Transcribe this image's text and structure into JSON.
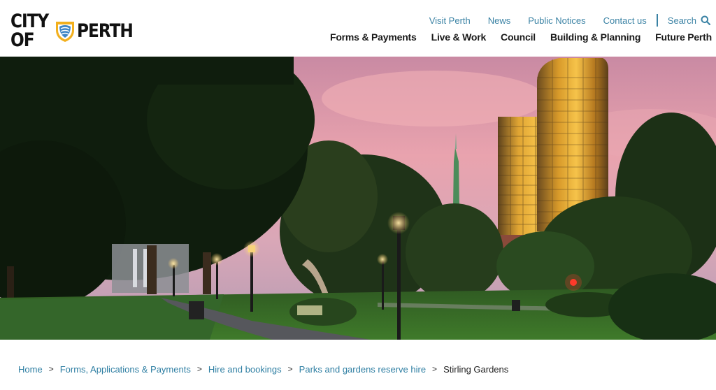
{
  "logo": {
    "left_text": "CITY OF",
    "right_text": "PERTH"
  },
  "utility_nav": {
    "links": [
      "Visit Perth",
      "News",
      "Public Notices",
      "Contact us"
    ],
    "search_label": "Search"
  },
  "main_nav": {
    "items": [
      "Forms & Payments",
      "Live & Work",
      "Council",
      "Building & Planning",
      "Future Perth"
    ]
  },
  "hero": {
    "image": "Stirling Gardens at dusk with gold glass towers"
  },
  "breadcrumb": {
    "links": [
      "Home",
      "Forms, Applications & Payments",
      "Hire and bookings",
      "Parks and gardens reserve hire"
    ],
    "separator": ">",
    "current": "Stirling Gardens"
  },
  "colors": {
    "link": "#3a82a4",
    "text": "#1a1a1a",
    "accent_gold": "#f2b01e"
  }
}
